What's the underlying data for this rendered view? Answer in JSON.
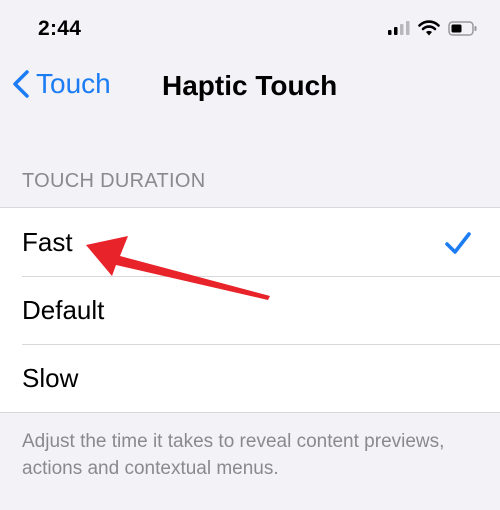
{
  "status_bar": {
    "time": "2:44",
    "icons": [
      "cellular-signal-icon",
      "wifi-icon",
      "battery-icon"
    ]
  },
  "nav": {
    "back_label": "Touch",
    "title": "Haptic Touch"
  },
  "section": {
    "header": "TOUCH DURATION",
    "options": [
      {
        "label": "Fast",
        "selected": true
      },
      {
        "label": "Default",
        "selected": false
      },
      {
        "label": "Slow",
        "selected": false
      }
    ],
    "footer": "Adjust the time it takes to reveal content previews, actions and contextual menus."
  },
  "colors": {
    "accent": "#1c7cf4",
    "annotation_arrow": "#e8232a",
    "background": "#f2f2f7",
    "secondary_text": "#8a8a8e"
  }
}
